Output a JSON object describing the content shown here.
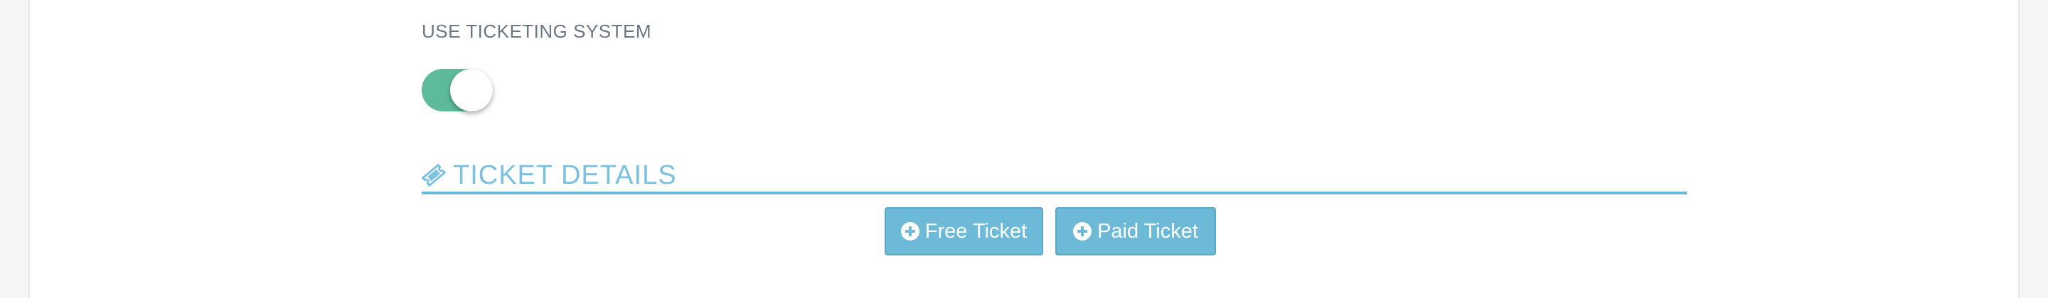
{
  "ticketing": {
    "label": "USE TICKETING SYSTEM",
    "enabled": true
  },
  "ticket_details": {
    "title": "TICKET DETAILS",
    "icon": "ticket-icon"
  },
  "actions": {
    "free_ticket_label": "Free Ticket",
    "paid_ticket_label": "Paid Ticket",
    "icon": "plus-circle-icon"
  },
  "colors": {
    "toggle_on": "#5dbb9a",
    "accent": "#6ab9dd",
    "button": "#6cbad8"
  }
}
